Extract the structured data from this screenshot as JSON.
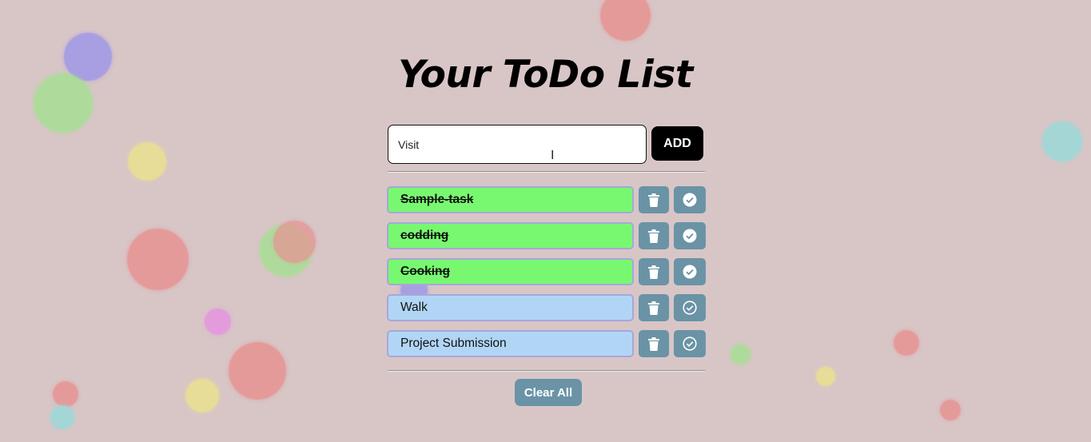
{
  "page": {
    "title": "Your ToDo List",
    "background_color": "#d8c6c7"
  },
  "input": {
    "value": "Visit",
    "add_label": "ADD"
  },
  "tasks": [
    {
      "text": "Sample-task",
      "completed": true
    },
    {
      "text": "codding",
      "completed": true
    },
    {
      "text": "Cooking",
      "completed": true
    },
    {
      "text": "Walk",
      "completed": false
    },
    {
      "text": "Project Submission",
      "completed": false
    }
  ],
  "icons": {
    "delete": "trash-icon",
    "complete_done": "check-circle-filled-icon",
    "complete_pending": "check-circle-outline-icon"
  },
  "colors": {
    "completed_task": "#78f870",
    "pending_task": "#b1d6f5",
    "action_button": "#6a93a6",
    "add_button": "#000000"
  },
  "clear_all_label": "Clear All"
}
